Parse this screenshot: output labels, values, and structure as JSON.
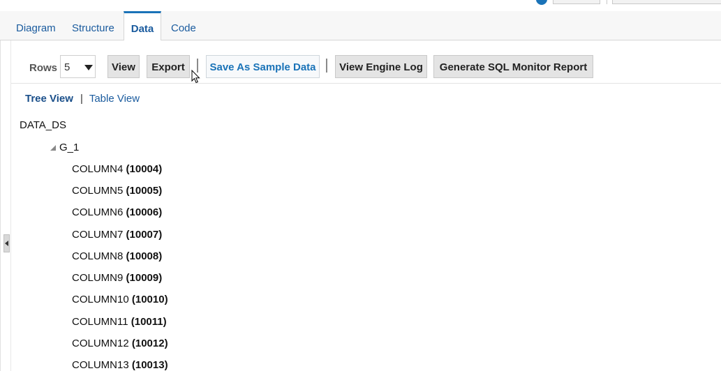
{
  "tabs": [
    {
      "label": "Diagram",
      "active": false
    },
    {
      "label": "Structure",
      "active": false
    },
    {
      "label": "Data",
      "active": true
    },
    {
      "label": "Code",
      "active": false
    }
  ],
  "toolbar": {
    "rows_label": "Rows",
    "rows_value": "5",
    "view_label": "View",
    "export_label": "Export",
    "save_sample_label": "Save As Sample Data",
    "engine_log_label": "View Engine Log",
    "sql_monitor_label": "Generate SQL Monitor Report"
  },
  "view_switch": {
    "tree_view": "Tree View",
    "separator": "|",
    "table_view": "Table View"
  },
  "tree": {
    "root": "DATA_DS",
    "group": "G_1",
    "items": [
      {
        "name": "COLUMN4",
        "value": "(10004)"
      },
      {
        "name": "COLUMN5",
        "value": "(10005)"
      },
      {
        "name": "COLUMN6",
        "value": "(10006)"
      },
      {
        "name": "COLUMN7",
        "value": "(10007)"
      },
      {
        "name": "COLUMN8",
        "value": "(10008)"
      },
      {
        "name": "COLUMN9",
        "value": "(10009)"
      },
      {
        "name": "COLUMN10",
        "value": "(10010)"
      },
      {
        "name": "COLUMN11",
        "value": "(10011)"
      },
      {
        "name": "COLUMN12",
        "value": "(10012)"
      },
      {
        "name": "COLUMN13",
        "value": "(10013)"
      }
    ]
  },
  "colors": {
    "accent": "#1a73b8",
    "link": "#1a5b9e",
    "tab_bar_bg": "#f7f7f7",
    "button_bg": "#e4e4e4"
  }
}
